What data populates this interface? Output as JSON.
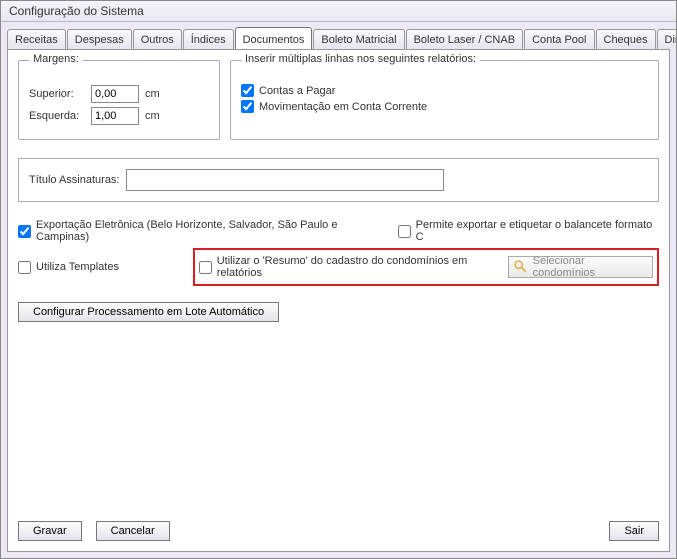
{
  "window": {
    "title": "Configuração do Sistema"
  },
  "tabs": {
    "receitas": "Receitas",
    "despesas": "Despesas",
    "outros": "Outros",
    "indices": "Índices",
    "documentos": "Documentos",
    "boleto_matricial": "Boleto Matricial",
    "boleto_laser": "Boleto Laser / CNAB",
    "conta_pool": "Conta Pool",
    "cheques": "Cheques",
    "diretorios": "Diretórios"
  },
  "margins": {
    "legend": "Margens:",
    "superior_label": "Superior:",
    "superior_value": "0,00",
    "esquerda_label": "Esquerda:",
    "esquerda_value": "1,00",
    "unit": "cm"
  },
  "insert": {
    "legend": "Inserir múltiplas linhas nos seguintes relatórios:",
    "contas_a_pagar": "Contas a Pagar",
    "mov_conta_corrente": "Movimentação em Conta Corrente"
  },
  "title_sig": {
    "label": "Título Assinaturas:",
    "value": ""
  },
  "checks": {
    "exportacao": "Exportação Eletrônica (Belo Horizonte, Salvador, São Paulo e Campinas)",
    "permite_exportar": "Permite exportar e etiquetar o balancete formato C",
    "utiliza_templates": "Utiliza Templates",
    "utilizar_resumo": "Utilizar o 'Resumo' do cadastro do condomínios em relatórios",
    "selecionar_condominios": "Selecionar condomínios"
  },
  "buttons": {
    "configurar_lote": "Configurar Processamento em Lote Automático",
    "gravar": "Gravar",
    "cancelar": "Cancelar",
    "sair": "Sair"
  }
}
